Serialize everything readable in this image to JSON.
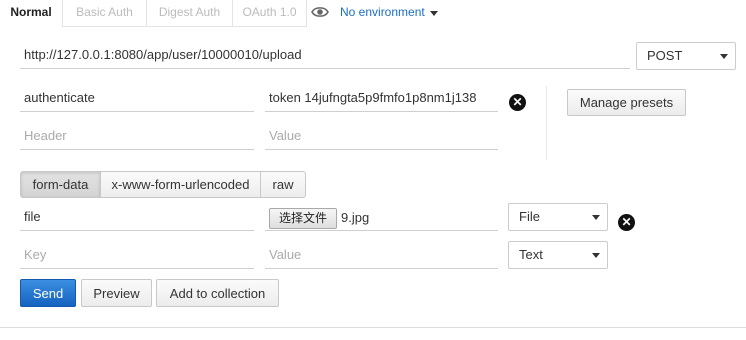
{
  "tabs": [
    {
      "label": "Normal",
      "active": true
    },
    {
      "label": "Basic Auth",
      "active": false
    },
    {
      "label": "Digest Auth",
      "active": false
    },
    {
      "label": "OAuth 1.0",
      "active": false
    }
  ],
  "environment": {
    "icon": "eye-icon",
    "label": "No environment"
  },
  "request": {
    "url": "http://127.0.0.1:8080/app/user/10000010/upload",
    "method": "POST"
  },
  "headers": {
    "rows": [
      {
        "key": "authenticate",
        "value": "token 14jufngta5p9fmfo1p8nm1j138"
      }
    ],
    "key_placeholder": "Header",
    "value_placeholder": "Value",
    "manage_presets_label": "Manage presets"
  },
  "body_modes": [
    "form-data",
    "x-www-form-urlencoded",
    "raw"
  ],
  "active_body_mode": "form-data",
  "form_data": {
    "rows": [
      {
        "key": "file",
        "file_button_label": "选择文件",
        "file_name": "9.jpg",
        "type": "File"
      }
    ],
    "key_placeholder": "Key",
    "value_placeholder": "Value",
    "new_type": "Text"
  },
  "actions": {
    "send_label": "Send",
    "preview_label": "Preview",
    "add_to_collection_label": "Add to collection"
  },
  "colors": {
    "link": "#1a6fc4",
    "primary": "#1563c0"
  }
}
